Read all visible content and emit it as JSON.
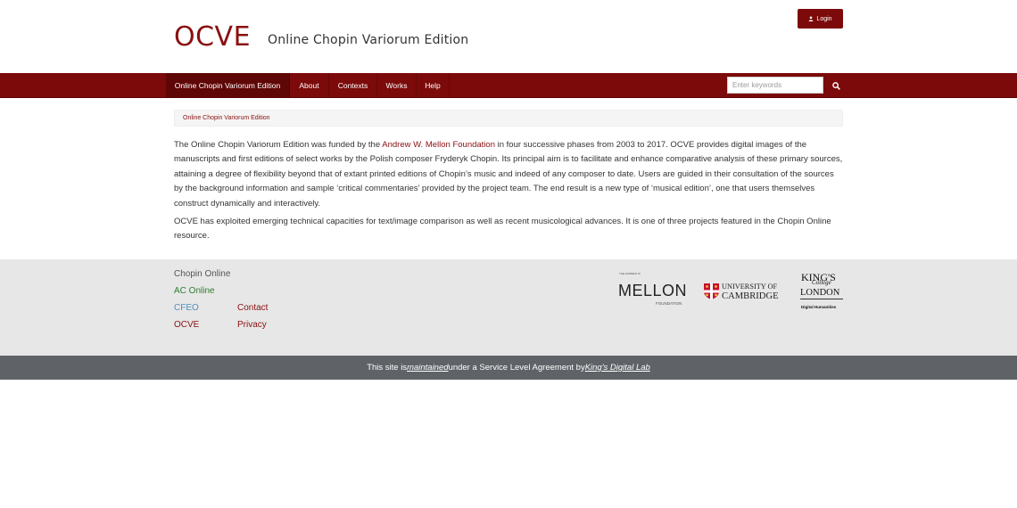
{
  "header": {
    "logo": "OCVE",
    "subtitle": "Online Chopin Variorum Edition",
    "login_label": "Login",
    "login_icon": "user-icon"
  },
  "nav": {
    "items": [
      {
        "label": "Online Chopin Variorum Edition",
        "active": true
      },
      {
        "label": "About"
      },
      {
        "label": "Contexts"
      },
      {
        "label": "Works"
      },
      {
        "label": "Help"
      }
    ],
    "search_placeholder": "Enter keywords",
    "search_icon": "search-icon"
  },
  "breadcrumb": {
    "current": "Online Chopin Variorum Edition"
  },
  "content": {
    "p1_before": "The Online Chopin Variorum Edition was funded by the ",
    "p1_link": "Andrew W. Mellon Foundation",
    "p1_after": " in four successive phases from 2003 to 2017. OCVE provides digital images of the manuscripts and first editions of select works by the Polish composer Fryderyk Chopin. Its principal aim is to facilitate and enhance comparative analysis of these primary sources, attaining a degree of flexibility beyond that of extant printed editions of Chopin’s music and indeed of any composer to date. Users are guided in their consultation of the sources by the background information and sample ‘critical commentaries’ provided by the project team. The end result is a new type of ‘musical edition’, one that users themselves construct dynamically and interactively.",
    "p2": "OCVE has exploited emerging technical capacities for text/image comparison as well as recent musicological advances. It is one of three projects featured in the Chopin Online resource."
  },
  "footer": {
    "title": "Chopin Online",
    "links": {
      "ac_online": "AC Online",
      "cfeo": "CFEO",
      "ocve": "OCVE",
      "contact": "Contact",
      "privacy": "Privacy"
    },
    "logos": {
      "mellon_small": "THE ANDREW W.",
      "mellon_big": "MELLON",
      "mellon_foundation": "FOUNDATION",
      "cambridge_line1": "UNIVERSITY OF",
      "cambridge_line2": "CAMBRIDGE",
      "kings_line1": "KING'S",
      "kings_line2": "College",
      "kings_line3": "LONDON",
      "kings_dh": "Digital Humanities"
    }
  },
  "bottombar": {
    "before": "This site is ",
    "maintained": "maintained",
    "middle": " under a Service Level Agreement by ",
    "lab": "King's Digital Lab"
  },
  "colors": {
    "brand": "#7c0a0a",
    "nav_active": "#5f0606",
    "footer_bg": "#e7e7e7",
    "bottombar_bg": "#5f6367",
    "ac_green": "#2e7d32",
    "cfeo_blue": "#4f8fbf"
  }
}
